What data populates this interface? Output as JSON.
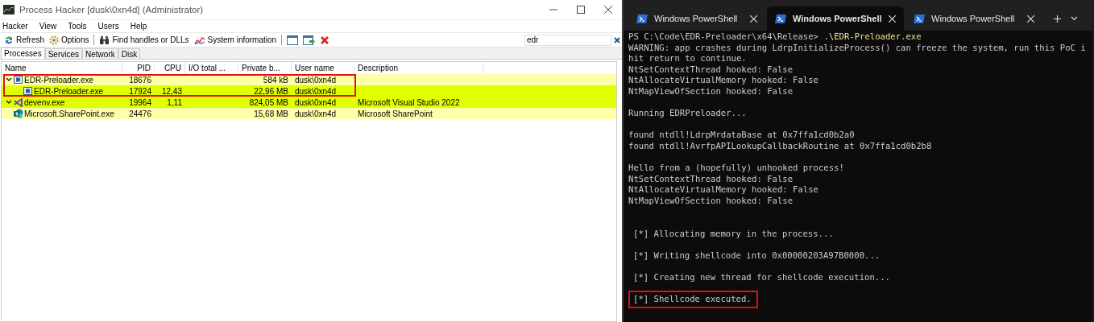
{
  "process_hacker": {
    "title": "Process Hacker [dusk\\0xn4d] (Administrator)",
    "menu": [
      "Hacker",
      "View",
      "Tools",
      "Users",
      "Help"
    ],
    "toolbar": [
      {
        "kind": "refresh",
        "label": "Refresh"
      },
      {
        "kind": "options",
        "label": "Options"
      },
      {
        "kind": "separator"
      },
      {
        "kind": "find",
        "label": "Find handles or DLLs"
      },
      {
        "kind": "sysinfo",
        "label": "System information"
      },
      {
        "kind": "separator"
      },
      {
        "kind": "window"
      },
      {
        "kind": "window-go"
      },
      {
        "kind": "terminate"
      }
    ],
    "search": {
      "value": "edr"
    },
    "tabs": [
      {
        "label": "Processes",
        "selected": true
      },
      {
        "label": "Services",
        "selected": false
      },
      {
        "label": "Network",
        "selected": false
      },
      {
        "label": "Disk",
        "selected": false
      }
    ],
    "columns": [
      "Name",
      "PID",
      "CPU",
      "I/O total ...",
      "Private b...",
      "User name",
      "Description"
    ],
    "processes": [
      {
        "name": "EDR-Preloader.exe",
        "kind": "app",
        "pid": "18676",
        "private_bytes": "584 kB",
        "user_name": "dusk\\0xn4d",
        "color": "#ffffaa",
        "expanded": true,
        "highlighted": true,
        "children": [
          {
            "name": "EDR-Preloader.exe",
            "kind": "app",
            "pid": "17924",
            "cpu": "12,43",
            "private_bytes": "22,96 MB",
            "user_name": "dusk\\0xn4d",
            "color": "#e0ff00",
            "highlighted": false
          }
        ]
      },
      {
        "name": "devenv.exe",
        "kind": "vs",
        "pid": "19964",
        "cpu": "1,11",
        "private_bytes": "824,05 MB",
        "user_name": "dusk\\0xn4d",
        "description": "Microsoft Visual Studio 2022",
        "color": "#e0ff00",
        "expanded": true,
        "highlighted": false
      },
      {
        "name": "Microsoft.SharePoint.exe",
        "kind": "sharepoint",
        "pid": "24476",
        "private_bytes": "15,68 MB",
        "user_name": "dusk\\0xn4d",
        "description": "Microsoft SharePoint",
        "color": "#ffffaa",
        "highlighted": false
      }
    ]
  },
  "terminal": {
    "tabs": [
      {
        "title": "Windows PowerShell",
        "selected": false
      },
      {
        "title": "Windows PowerShell",
        "selected": true
      },
      {
        "title": "Windows PowerShell",
        "selected": false
      }
    ],
    "lines": [
      {
        "kind": "prompt",
        "prompt": "PS C:\\Code\\EDR-Preloader\\x64\\Release>",
        "command": ".\\EDR-Preloader.exe",
        "highlighted": false
      },
      {
        "kind": "output",
        "text": "WARNING: app crashes during LdrpInitializeProcess() can freeze the system, run this PoC i",
        "highlighted": false
      },
      {
        "kind": "output",
        "text": "hit return to continue.",
        "highlighted": false
      },
      {
        "kind": "output",
        "text": "NtSetContextThread hooked: False",
        "highlighted": false
      },
      {
        "kind": "output",
        "text": "NtAllocateVirtualMemory hooked: False",
        "highlighted": false
      },
      {
        "kind": "output",
        "text": "NtMapViewOfSection hooked: False",
        "highlighted": false
      },
      {
        "kind": "blank"
      },
      {
        "kind": "output",
        "text": "Running EDRPreloader...",
        "highlighted": false
      },
      {
        "kind": "blank"
      },
      {
        "kind": "output",
        "text": "found ntdll!LdrpMrdataBase at 0x7ffa1cd0b2a0",
        "highlighted": false
      },
      {
        "kind": "output",
        "text": "found ntdll!AvrfpAPILookupCallbackRoutine at 0x7ffa1cd0b2b8",
        "highlighted": false
      },
      {
        "kind": "blank"
      },
      {
        "kind": "output",
        "text": "Hello from a (hopefully) unhooked process!",
        "highlighted": false
      },
      {
        "kind": "output",
        "text": "NtSetContextThread hooked: False",
        "highlighted": false
      },
      {
        "kind": "output",
        "text": "NtAllocateVirtualMemory hooked: False",
        "highlighted": false
      },
      {
        "kind": "output",
        "text": "NtMapViewOfSection hooked: False",
        "highlighted": false
      },
      {
        "kind": "blank"
      },
      {
        "kind": "blank"
      },
      {
        "kind": "step",
        "text": "[*] Allocating memory in the process...",
        "highlighted": false
      },
      {
        "kind": "blank"
      },
      {
        "kind": "step",
        "text": "[*] Writing shellcode into 0x00000203A97B0000...",
        "highlighted": false
      },
      {
        "kind": "blank"
      },
      {
        "kind": "step",
        "text": "[*] Creating new thread for shellcode execution...",
        "highlighted": false
      },
      {
        "kind": "blank"
      },
      {
        "kind": "step",
        "text": "[*] Shellcode executed.",
        "highlighted": true
      }
    ]
  }
}
